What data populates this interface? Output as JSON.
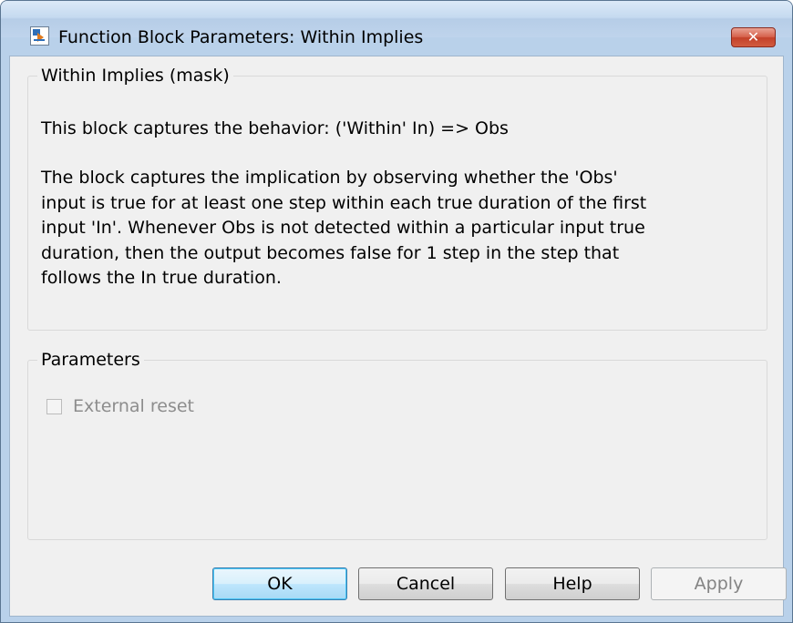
{
  "window": {
    "title": "Function Block Parameters: Within Implies",
    "close_label": "✕",
    "app_icon": "simulink-block-icon"
  },
  "mask_group": {
    "legend": "Within Implies (mask)",
    "summary": "This block captures the behavior: ('Within' In) => Obs",
    "description_lines": [
      "The block captures the implication by observing whether the 'Obs'",
      "input is true for at least one step within each true duration of the first",
      "input 'In'. Whenever Obs is not detected within a particular input true",
      "duration, then the output becomes false for 1 step in the step that",
      "follows the In true duration."
    ]
  },
  "params_group": {
    "legend": "Parameters",
    "external_reset": {
      "label": "External reset",
      "checked": false,
      "enabled": false
    }
  },
  "buttons": {
    "ok": "OK",
    "cancel": "Cancel",
    "help": "Help",
    "apply": "Apply"
  }
}
